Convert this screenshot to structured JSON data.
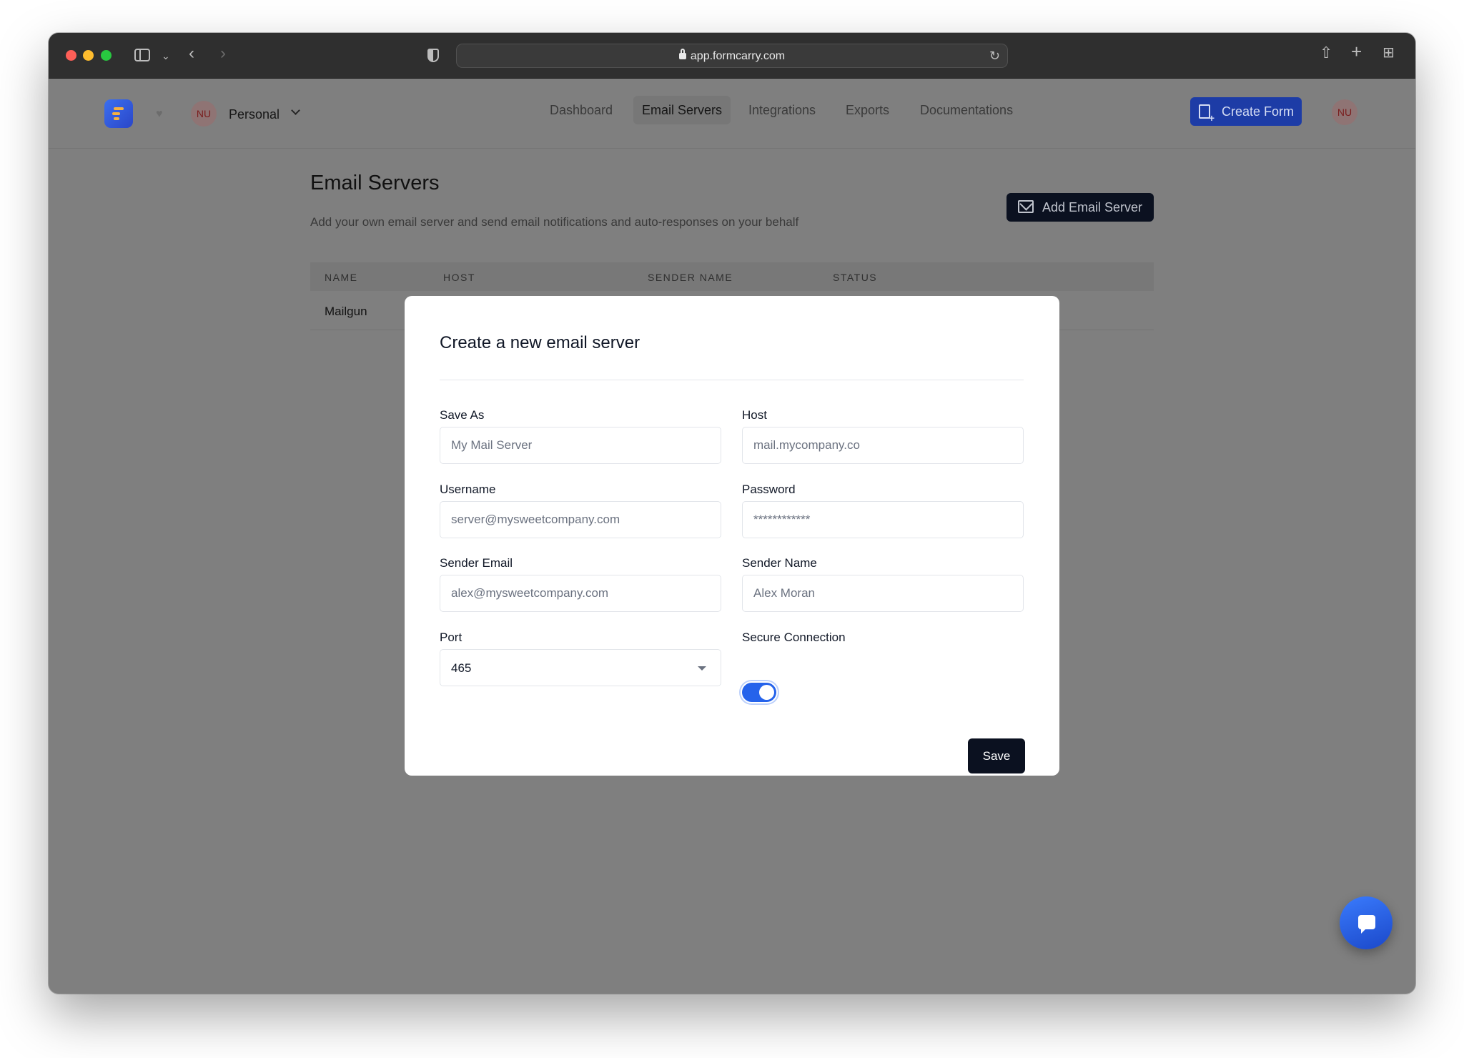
{
  "browser": {
    "url": "app.formcarry.com"
  },
  "header": {
    "workspace_avatar": "NU",
    "workspace_name": "Personal",
    "nav": [
      {
        "label": "Dashboard"
      },
      {
        "label": "Email Servers",
        "active": true
      },
      {
        "label": "Integrations"
      },
      {
        "label": "Exports"
      },
      {
        "label": "Documentations"
      }
    ],
    "create_form_label": "Create Form",
    "user_avatar": "NU"
  },
  "page": {
    "title": "Email Servers",
    "subtitle": "Add your own email server and send email notifications and auto-responses on your behalf",
    "add_button_label": "Add Email Server",
    "table": {
      "headers": [
        "NAME",
        "HOST",
        "SENDER NAME",
        "STATUS"
      ],
      "rows": [
        {
          "name": "Mailgun"
        }
      ]
    }
  },
  "modal": {
    "title": "Create a new email server",
    "fields": {
      "save_as": {
        "label": "Save As",
        "placeholder": "My Mail Server"
      },
      "host": {
        "label": "Host",
        "placeholder": "mail.mycompany.co"
      },
      "username": {
        "label": "Username",
        "placeholder": "server@mysweetcompany.com"
      },
      "password": {
        "label": "Password",
        "placeholder": "************"
      },
      "sender_email": {
        "label": "Sender Email",
        "placeholder": "alex@mysweetcompany.com"
      },
      "sender_name": {
        "label": "Sender Name",
        "placeholder": "Alex Moran"
      },
      "port": {
        "label": "Port",
        "value": "465"
      },
      "secure_connection": {
        "label": "Secure Connection",
        "enabled": true
      }
    },
    "save_label": "Save"
  },
  "colors": {
    "accent": "#2563eb",
    "primary_dark": "#0b1120",
    "overlay": "#7f7f7f"
  },
  "icons": [
    "shield-icon",
    "lock-icon",
    "reload-icon",
    "share-icon",
    "plus-icon",
    "tabs-grid-icon",
    "heart-icon",
    "chevron-down-icon",
    "document-plus-icon",
    "mail-plus-icon",
    "caret-down-icon",
    "chat-icon"
  ]
}
